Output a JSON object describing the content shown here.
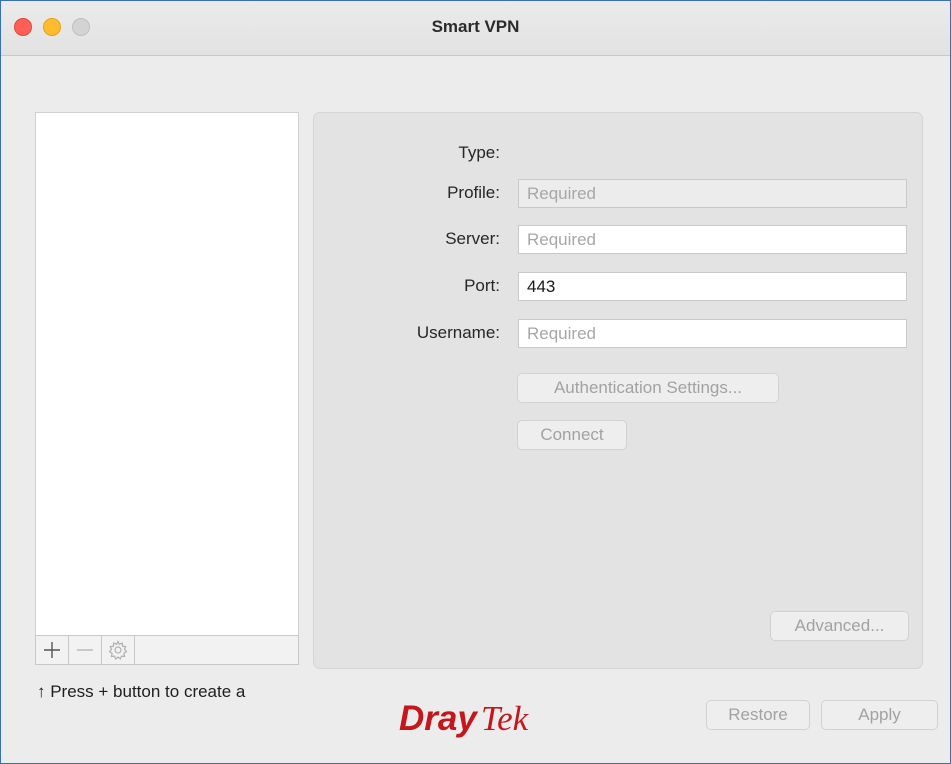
{
  "window": {
    "title": "Smart VPN"
  },
  "sidebar": {
    "hint": "↑ Press + button to create a",
    "toolbar": {
      "add": "+",
      "remove": "—"
    }
  },
  "form": {
    "type_label": "Type:",
    "profile_label": "Profile:",
    "profile_placeholder": "Required",
    "server_label": "Server:",
    "server_placeholder": "Required",
    "port_label": "Port:",
    "port_value": "443",
    "username_label": "Username:",
    "username_placeholder": "Required"
  },
  "buttons": {
    "auth_settings": "Authentication Settings...",
    "connect": "Connect",
    "advanced": "Advanced...",
    "restore": "Restore",
    "apply": "Apply"
  },
  "logo": {
    "part1": "Dray",
    "part2": "Tek",
    "color": "#c4161c"
  }
}
